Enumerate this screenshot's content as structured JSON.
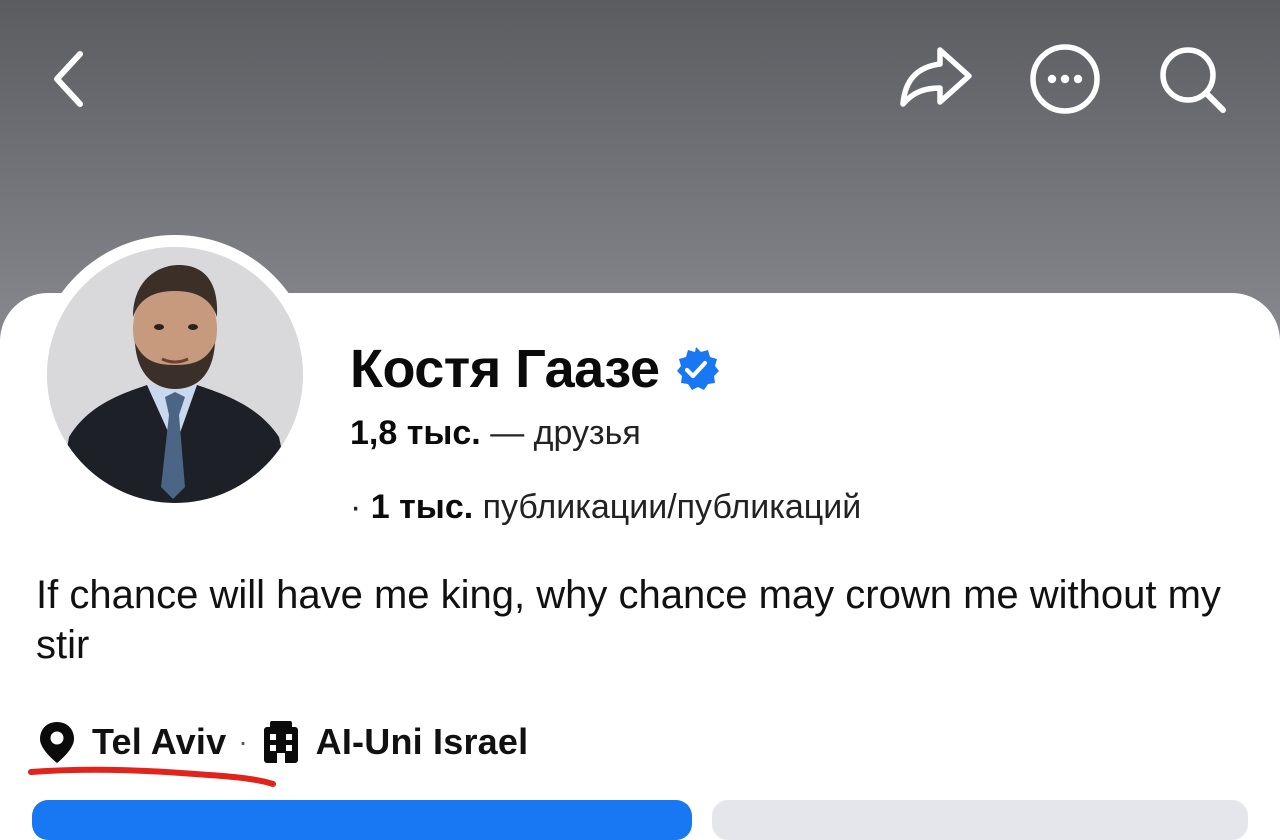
{
  "profile": {
    "name": "Костя Гаазе",
    "friends_count": "1,8 тыс.",
    "friends_label": "— друзья",
    "posts_bullet": "·",
    "posts_count": "1 тыс.",
    "posts_label": "публикации/публикаций",
    "bio": "If chance will have me king, why chance may crown me without my stir",
    "location": "Tel Aviv",
    "separator": "·",
    "workplace": "AI-Uni Israel"
  },
  "icons": {
    "back": "chevron-left-icon",
    "share": "share-arrow-icon",
    "more": "more-dots-icon",
    "search": "search-icon",
    "verified": "verified-badge-icon",
    "location": "map-pin-icon",
    "workplace": "building-icon"
  },
  "colors": {
    "accent": "#1877f2",
    "annotation": "#e0241b"
  }
}
